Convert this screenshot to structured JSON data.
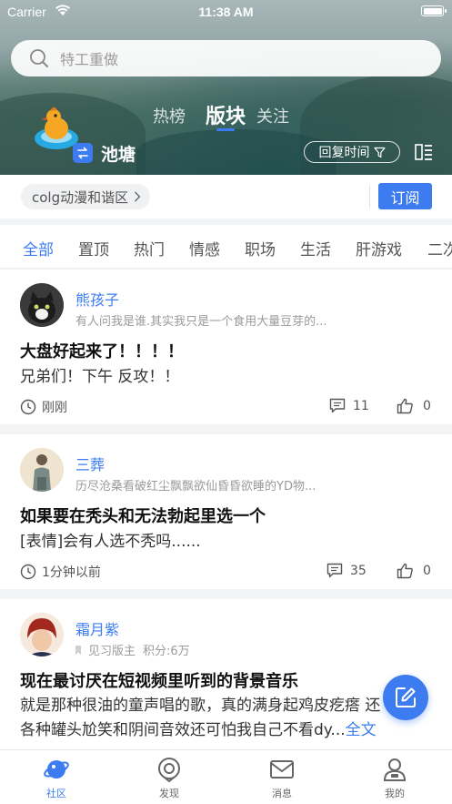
{
  "status_bar": {
    "carrier": "Carrier",
    "time": "11:38 AM"
  },
  "search": {
    "placeholder": "特工重做"
  },
  "top_tabs": [
    "热榜",
    "版块",
    "关注"
  ],
  "board": {
    "name": "池塘",
    "sort_label": "回复时间"
  },
  "sub_board": {
    "name": "colg动漫和谐区",
    "subscribe_label": "订阅"
  },
  "categories": [
    "全部",
    "置顶",
    "热门",
    "情感",
    "职场",
    "生活",
    "肝游戏",
    "二次"
  ],
  "posts": [
    {
      "author": "熊孩子",
      "signature": "有人问我是谁.其实我只是一个食用大量豆芽的...",
      "title": "大盘好起来了！！！！",
      "body": "兄弟们！下午 反攻！！",
      "time": "刚刚",
      "comments": "11",
      "likes": "0"
    },
    {
      "author": "三葬",
      "signature": "历尽沧桑看破红尘飘飘欲仙昏昏欲睡的YD物...",
      "title": "如果要在秃头和无法勃起里选一个",
      "body": "[表情]会有人选不秃吗......",
      "time": "1分钟以前",
      "comments": "35",
      "likes": "0"
    },
    {
      "author": "霜月紫",
      "badge": "见习版主",
      "points": "积分:6万",
      "title": "现在最讨厌在短视频里听到的背景音乐",
      "body_line1": "就是那种很油的童声唱的歌，真的满身起鸡皮疙瘩 还",
      "body_line2": "各种罐头尬笑和阴间音效还可怕我自己不看dy...",
      "full_text": "全文"
    }
  ],
  "bottom_nav": [
    "社区",
    "发现",
    "消息",
    "我的"
  ],
  "colors": {
    "accent": "#3d7cf0"
  }
}
